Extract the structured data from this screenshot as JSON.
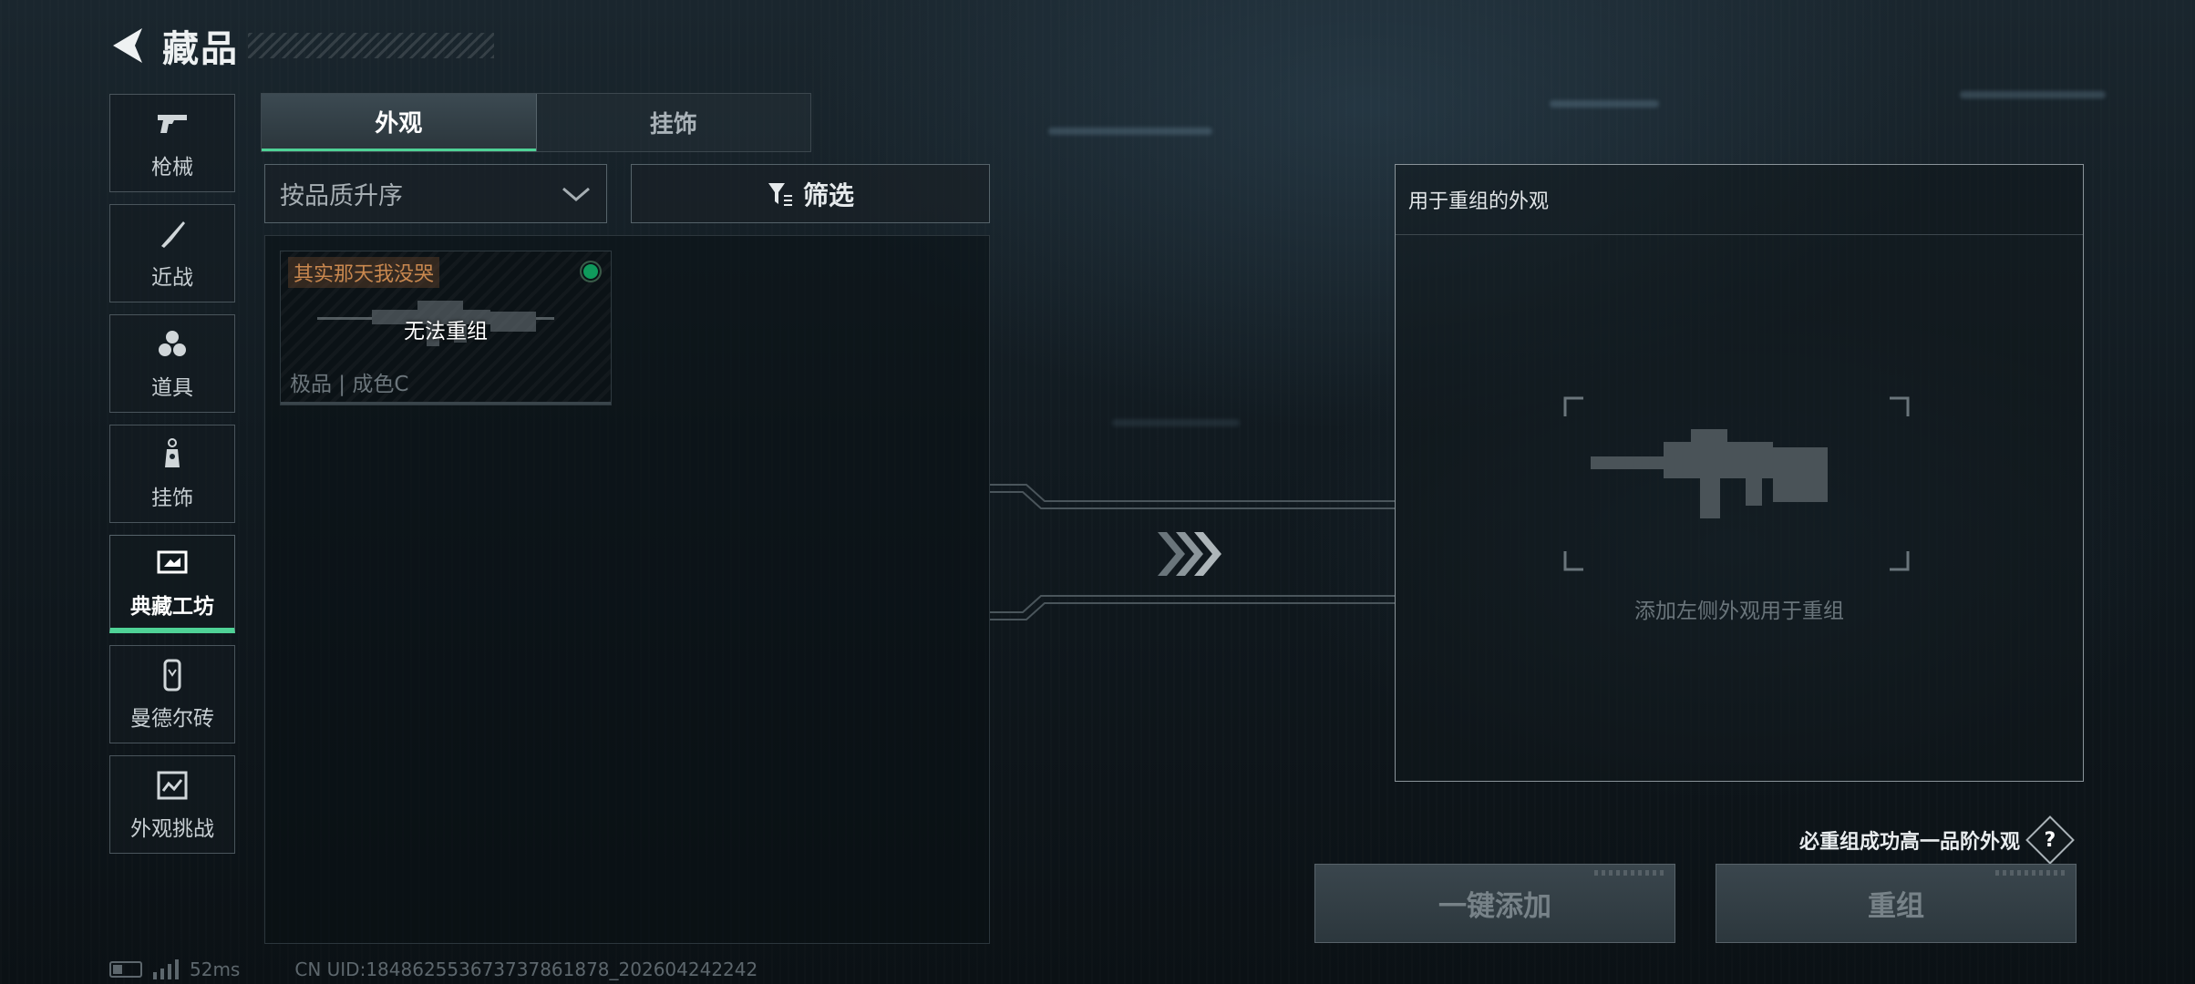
{
  "header": {
    "title": "藏品"
  },
  "nav": {
    "items": [
      {
        "label": "枪械",
        "icon": "pistol-icon",
        "active": false
      },
      {
        "label": "近战",
        "icon": "knife-icon",
        "active": false
      },
      {
        "label": "道具",
        "icon": "grenade-icon",
        "active": false
      },
      {
        "label": "挂饰",
        "icon": "charm-icon",
        "active": false
      },
      {
        "label": "典藏工坊",
        "icon": "workshop-icon",
        "active": true
      },
      {
        "label": "曼德尔砖",
        "icon": "brick-icon",
        "active": false
      },
      {
        "label": "外观挑战",
        "icon": "challenge-icon",
        "active": false
      }
    ]
  },
  "tabs": [
    {
      "label": "外观",
      "active": true
    },
    {
      "label": "挂饰",
      "active": false
    }
  ],
  "sort": {
    "label": "按品质升序"
  },
  "filter": {
    "label": "筛选"
  },
  "list": {
    "items": [
      {
        "name": "其实那天我没哭",
        "overlay": "无法重组",
        "quality": "极品 | 成色C",
        "status_color": "#0f9b5c"
      }
    ]
  },
  "reforge": {
    "title": "用于重组的外观",
    "hint": "添加左侧外观用于重组",
    "guarantee": "必重组成功高一品阶外观",
    "help_label": "?"
  },
  "buttons": {
    "add_label": "一键添加",
    "reforge_label": "重组"
  },
  "status_bar": {
    "ping": "52ms",
    "uid": "CN UID:18486255367373786​1878_202604242242"
  },
  "colors": {
    "accent": "#4fd296",
    "name_tag": "#c9884f"
  }
}
